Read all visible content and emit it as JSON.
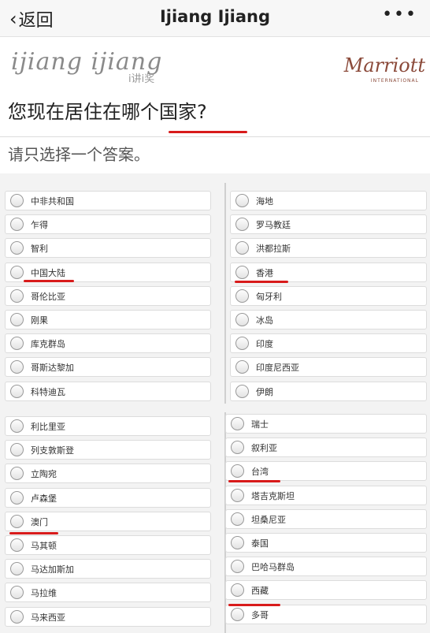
{
  "nav": {
    "back_label": "返回",
    "title": "Ijiang Ijiang",
    "more": "•••"
  },
  "brand": {
    "logo_text": "ijiang ijiang",
    "logo_sub": "i讲i奖",
    "partner_logo": "Marriott",
    "partner_sub": "INTERNATIONAL"
  },
  "question": "您现在居住在哪个国家?",
  "instruction": "请只选择一个答案。",
  "group1_left": [
    "中非共和国",
    "乍得",
    "智利",
    "中国大陆",
    "哥伦比亚",
    "刚果",
    "库克群岛",
    "哥斯达黎加",
    "科特迪瓦"
  ],
  "group1_right": [
    "海地",
    "罗马教廷",
    "洪都拉斯",
    "香港",
    "匈牙利",
    "冰岛",
    "印度",
    "印度尼西亚",
    "伊朗"
  ],
  "group2_left": [
    "利比里亚",
    "列支敦斯登",
    "立陶宛",
    "卢森堡",
    "澳门",
    "马其顿",
    "马达加斯加",
    "马拉维",
    "马来西亚"
  ],
  "group2_right": [
    "瑞士",
    "叙利亚",
    "台湾",
    "塔吉克斯坦",
    "坦桑尼亚",
    "泰国",
    "巴哈马群岛",
    "西藏",
    "多哥"
  ],
  "colors": {
    "underline": "#d81b1b",
    "partner": "#8b4a3a"
  }
}
